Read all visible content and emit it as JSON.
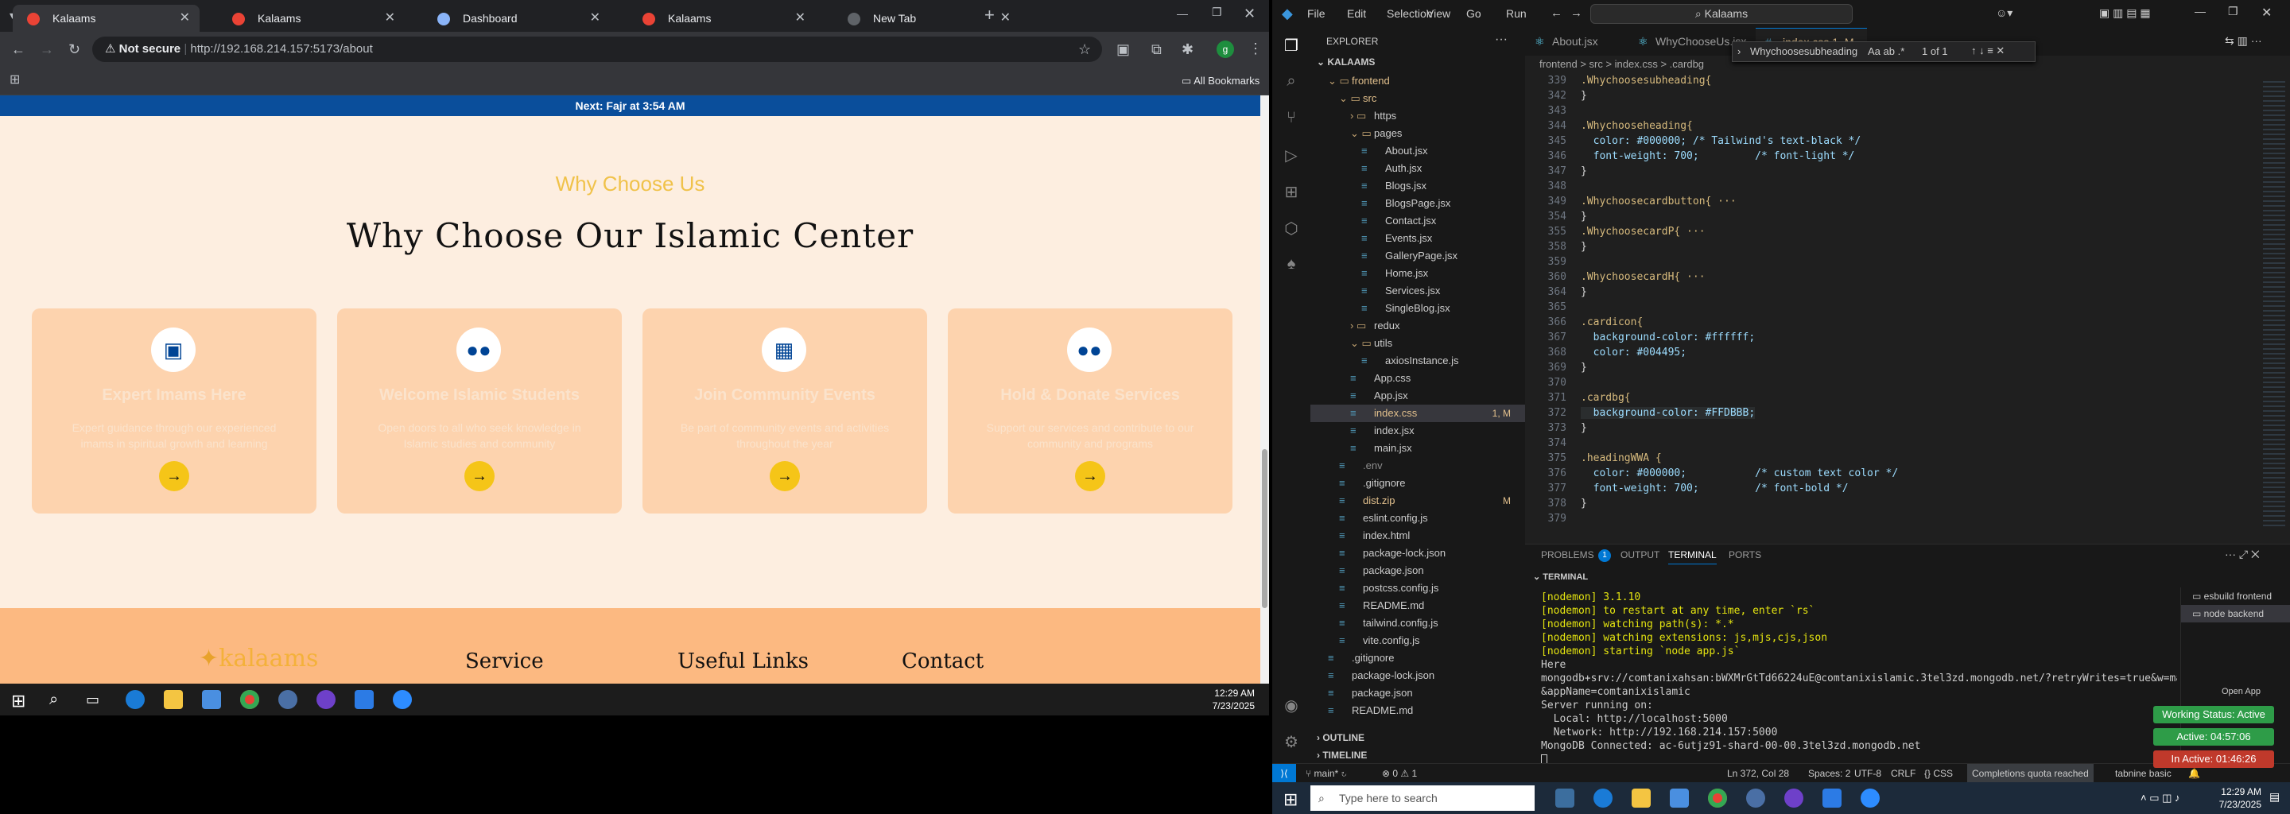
{
  "browser": {
    "tabs": [
      {
        "label": "Kalaams",
        "active": true
      },
      {
        "label": "Kalaams",
        "active": false
      },
      {
        "label": "Dashboard",
        "active": false
      },
      {
        "label": "Kalaams",
        "active": false
      },
      {
        "label": "New Tab",
        "active": false
      }
    ],
    "security_label": "Not secure",
    "url": "http://192.168.214.157:5173/about",
    "bookmarks_label": "All Bookmarks"
  },
  "site": {
    "banner": "Next: Fajr at 3:54 AM",
    "eyebrow": "Why Choose Us",
    "heading": "Why Choose Our Islamic Center",
    "cards": [
      {
        "icon": "chalkboard-teacher-icon",
        "title": "Expert Imams Here",
        "text": "Expert guidance through our experienced imams in spiritual growth and learning"
      },
      {
        "icon": "users-icon",
        "title": "Welcome Islamic Students",
        "text": "Open doors to all who seek knowledge in Islamic studies and community"
      },
      {
        "icon": "calendar-icon",
        "title": "Join Community Events",
        "text": "Be part of community events and activities throughout the year"
      },
      {
        "icon": "user-group-icon",
        "title": "Hold & Donate Services",
        "text": "Support our services and contribute to our community and programs"
      }
    ],
    "footer": {
      "logo": "kalaams",
      "columns": [
        "Service",
        "Useful Links",
        "Contact"
      ]
    }
  },
  "left_taskbar": {
    "time": "12:29 AM",
    "date": "7/23/2025"
  },
  "vscode": {
    "menu": [
      "File",
      "Edit",
      "Selection",
      "View",
      "Go",
      "Run"
    ],
    "search": "Kalaams",
    "explorer_title": "EXPLORER",
    "root": "KALAAMS",
    "tree": [
      {
        "name": "frontend",
        "indent": 1,
        "type": "folder-open",
        "color": "#e2c08d"
      },
      {
        "name": "src",
        "indent": 2,
        "type": "folder-open",
        "color": "#e2c08d"
      },
      {
        "name": "https",
        "indent": 3,
        "type": "folder",
        "color": "#ccc"
      },
      {
        "name": "pages",
        "indent": 3,
        "type": "folder-open",
        "color": "#ccc"
      },
      {
        "name": "About.jsx",
        "indent": 4,
        "type": "file",
        "color": "#ccc"
      },
      {
        "name": "Auth.jsx",
        "indent": 4,
        "type": "file",
        "color": "#ccc"
      },
      {
        "name": "Blogs.jsx",
        "indent": 4,
        "type": "file",
        "color": "#ccc"
      },
      {
        "name": "BlogsPage.jsx",
        "indent": 4,
        "type": "file",
        "color": "#ccc"
      },
      {
        "name": "Contact.jsx",
        "indent": 4,
        "type": "file",
        "color": "#ccc"
      },
      {
        "name": "Events.jsx",
        "indent": 4,
        "type": "file",
        "color": "#ccc"
      },
      {
        "name": "GalleryPage.jsx",
        "indent": 4,
        "type": "file",
        "color": "#ccc"
      },
      {
        "name": "Home.jsx",
        "indent": 4,
        "type": "file",
        "color": "#ccc"
      },
      {
        "name": "Services.jsx",
        "indent": 4,
        "type": "file",
        "color": "#ccc"
      },
      {
        "name": "SingleBlog.jsx",
        "indent": 4,
        "type": "file",
        "color": "#ccc"
      },
      {
        "name": "redux",
        "indent": 3,
        "type": "folder",
        "color": "#ccc"
      },
      {
        "name": "utils",
        "indent": 3,
        "type": "folder-open",
        "color": "#ccc"
      },
      {
        "name": "axiosInstance.js",
        "indent": 4,
        "type": "file",
        "color": "#ccc"
      },
      {
        "name": "App.css",
        "indent": 3,
        "type": "file",
        "color": "#ccc"
      },
      {
        "name": "App.jsx",
        "indent": 3,
        "type": "file",
        "color": "#ccc"
      },
      {
        "name": "index.css",
        "indent": 3,
        "type": "file",
        "color": "#e2c08d",
        "badge": "1, M",
        "selected": true
      },
      {
        "name": "index.jsx",
        "indent": 3,
        "type": "file",
        "color": "#ccc"
      },
      {
        "name": "main.jsx",
        "indent": 3,
        "type": "file",
        "color": "#ccc"
      },
      {
        "name": ".env",
        "indent": 2,
        "type": "file",
        "color": "#8c8c8c"
      },
      {
        "name": ".gitignore",
        "indent": 2,
        "type": "file",
        "color": "#ccc"
      },
      {
        "name": "dist.zip",
        "indent": 2,
        "type": "file",
        "color": "#e2c08d",
        "badge": "M"
      },
      {
        "name": "eslint.config.js",
        "indent": 2,
        "type": "file",
        "color": "#ccc"
      },
      {
        "name": "index.html",
        "indent": 2,
        "type": "file",
        "color": "#ccc"
      },
      {
        "name": "package-lock.json",
        "indent": 2,
        "type": "file",
        "color": "#ccc"
      },
      {
        "name": "package.json",
        "indent": 2,
        "type": "file",
        "color": "#ccc"
      },
      {
        "name": "postcss.config.js",
        "indent": 2,
        "type": "file",
        "color": "#ccc"
      },
      {
        "name": "README.md",
        "indent": 2,
        "type": "file",
        "color": "#ccc"
      },
      {
        "name": "tailwind.config.js",
        "indent": 2,
        "type": "file",
        "color": "#ccc"
      },
      {
        "name": "vite.config.js",
        "indent": 2,
        "type": "file",
        "color": "#ccc"
      },
      {
        "name": ".gitignore",
        "indent": 1,
        "type": "file",
        "color": "#ccc"
      },
      {
        "name": "package-lock.json",
        "indent": 1,
        "type": "file",
        "color": "#ccc"
      },
      {
        "name": "package.json",
        "indent": 1,
        "type": "file",
        "color": "#ccc"
      },
      {
        "name": "README.md",
        "indent": 1,
        "type": "file",
        "color": "#ccc"
      }
    ],
    "outline": "OUTLINE",
    "timeline": "TIMELINE",
    "editor_tabs": [
      {
        "label": "About.jsx",
        "active": false
      },
      {
        "label": "WhyChooseUs.jsx",
        "active": false
      },
      {
        "label": "index.css 1, M",
        "active": true
      }
    ],
    "breadcrumb": "frontend > src > index.css > .cardbg",
    "find": {
      "query": "Whychoosesubheading",
      "result": "1 of 1"
    },
    "code": [
      {
        "n": "339",
        "t": ".Whychoosesubheading{"
      },
      {
        "n": "342",
        "t": "}"
      },
      {
        "n": "343",
        "t": ""
      },
      {
        "n": "344",
        "t": ".Whychooseheading{"
      },
      {
        "n": "345",
        "t": "  color: #000000; /* Tailwind's text-black */"
      },
      {
        "n": "346",
        "t": "  font-weight: 700;         /* font-light */"
      },
      {
        "n": "347",
        "t": "}"
      },
      {
        "n": "348",
        "t": ""
      },
      {
        "n": "349",
        "t": ".Whychoosecardbutton{ ···"
      },
      {
        "n": "354",
        "t": "}"
      },
      {
        "n": "355",
        "t": ".WhychoosecardP{ ···"
      },
      {
        "n": "358",
        "t": "}"
      },
      {
        "n": "359",
        "t": ""
      },
      {
        "n": "360",
        "t": ".WhychoosecardH{ ···"
      },
      {
        "n": "364",
        "t": "}"
      },
      {
        "n": "365",
        "t": ""
      },
      {
        "n": "366",
        "t": ".cardicon{"
      },
      {
        "n": "367",
        "t": "  background-color: #ffffff;"
      },
      {
        "n": "368",
        "t": "  color: #004495;"
      },
      {
        "n": "369",
        "t": "}"
      },
      {
        "n": "370",
        "t": ""
      },
      {
        "n": "371",
        "t": ".cardbg{"
      },
      {
        "n": "372",
        "t": "  background-color: #FFDBBB;"
      },
      {
        "n": "373",
        "t": "}"
      },
      {
        "n": "374",
        "t": ""
      },
      {
        "n": "375",
        "t": ".headingWWA {"
      },
      {
        "n": "376",
        "t": "  color: #000000;           /* custom text color */"
      },
      {
        "n": "377",
        "t": "  font-weight: 700;         /* font-bold */"
      },
      {
        "n": "378",
        "t": "}"
      },
      {
        "n": "379",
        "t": ""
      }
    ],
    "panel_tabs": [
      "PROBLEMS",
      "OUTPUT",
      "TERMINAL",
      "PORTS"
    ],
    "problems_count": "1",
    "terminal_title": "TERMINAL",
    "terminal_lines": [
      "[nodemon] 3.1.10",
      "[nodemon] to restart at any time, enter `rs`",
      "[nodemon] watching path(s): *.*",
      "[nodemon] watching extensions: js,mjs,cjs,json",
      "[nodemon] starting `node app.js`",
      "Here",
      "mongodb+srv://comtanixahsan:bWXMrGtTd66224uE@comtanixislamic.3tel3zd.mongodb.net/?retryWrites=true&w=majority",
      "&appName=comtanixislamic",
      "Server running on:",
      "  Local: http://localhost:5000",
      "  Network: http://192.168.214.157:5000",
      "MongoDB Connected: ac-6utjz91-shard-00-00.3tel3zd.mongodb.net"
    ],
    "terminals": [
      "esbuild  frontend",
      "node  backend"
    ],
    "status": {
      "branch": "main*",
      "errors": "0",
      "warnings": "1",
      "position": "Ln 372, Col 28",
      "spaces": "Spaces: 2",
      "encoding": "UTF-8",
      "eol": "CRLF",
      "lang": "CSS",
      "completions": "Completions quota reached",
      "tabnine": "tabnine basic"
    }
  },
  "right_taskbar": {
    "search_placeholder": "Type here to search",
    "time": "12:29 AM",
    "date": "7/23/2025",
    "open_app": "Open App",
    "working_status": "Working Status: Active",
    "active_time": "Active: 04:57:06",
    "inactive_time": "In Active: 01:46:26"
  }
}
